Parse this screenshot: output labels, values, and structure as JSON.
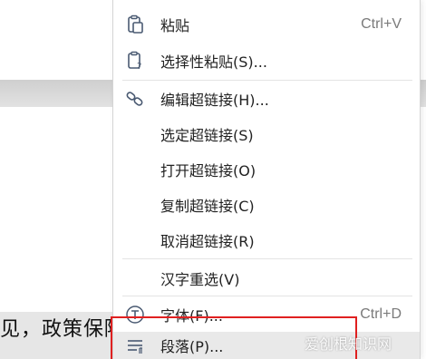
{
  "document": {
    "text": "见，政策保障"
  },
  "menu": {
    "items": [
      {
        "label": "粘贴",
        "shortcut": "Ctrl+V"
      },
      {
        "label": "选择性粘贴(S)..."
      },
      {
        "label": "编辑超链接(H)..."
      },
      {
        "label": "选定超链接(S)"
      },
      {
        "label": "打开超链接(O)"
      },
      {
        "label": "复制超链接(C)"
      },
      {
        "label": "取消超链接(R)"
      },
      {
        "label": "汉字重选(V)"
      },
      {
        "label": "字体(F)...",
        "shortcut": "Ctrl+D"
      },
      {
        "label": "段落(P)..."
      }
    ]
  },
  "watermark": "爱创根知识网",
  "colors": {
    "annotation": "#e02020",
    "hover": "#e9e9e9",
    "icon": "#4a5a72"
  }
}
